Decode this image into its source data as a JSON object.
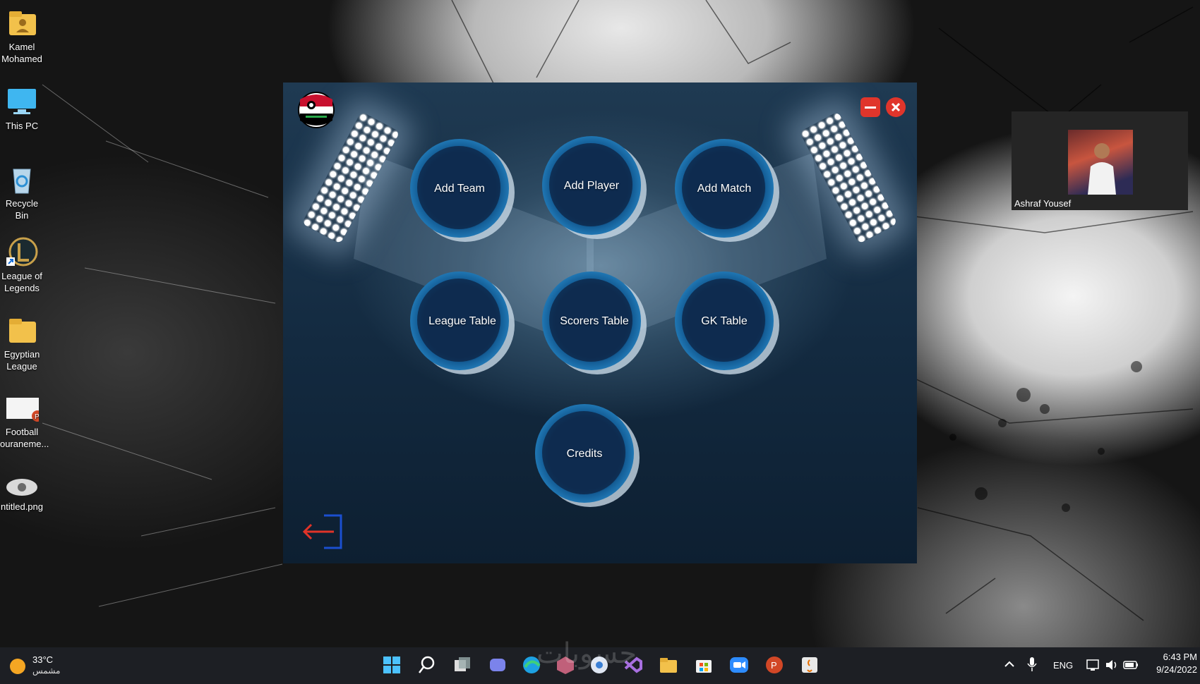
{
  "desktop": {
    "icons": [
      {
        "label": "Kamel Mohamed",
        "icon": "user-folder-icon"
      },
      {
        "label": "This PC",
        "icon": "monitor-icon"
      },
      {
        "label": "Recycle Bin",
        "icon": "recycle-bin-icon"
      },
      {
        "label": "League of Legends",
        "icon": "league-of-legends-icon"
      },
      {
        "label": "Egyptian League",
        "icon": "folder-icon"
      },
      {
        "label": "Football ouraneme...",
        "icon": "powerpoint-file-icon"
      },
      {
        "label": "ntitled.png",
        "icon": "image-file-icon"
      }
    ]
  },
  "app": {
    "logo": "league-logo-icon",
    "buttons": {
      "add_team": "Add Team",
      "add_player": "Add Player",
      "add_match": "Add Match",
      "league_table": "League Table",
      "scorers_table": "Scorers Table",
      "gk_table": "GK Table",
      "credits": "Credits"
    },
    "window_controls": {
      "minimize": "minimize-icon",
      "close": "close-icon"
    },
    "back": "logout-arrow-icon",
    "colors": {
      "minimize": "#e0352b",
      "close": "#e0352b",
      "accent": "#1a78b4"
    }
  },
  "video_call": {
    "participant": "Ashraf Yousef"
  },
  "taskbar": {
    "weather_temp": "33°C",
    "weather_desc": "مشمس",
    "language": "ENG",
    "time": "6:43 PM",
    "date": "9/24/2022",
    "watermark": "حسوبات"
  }
}
